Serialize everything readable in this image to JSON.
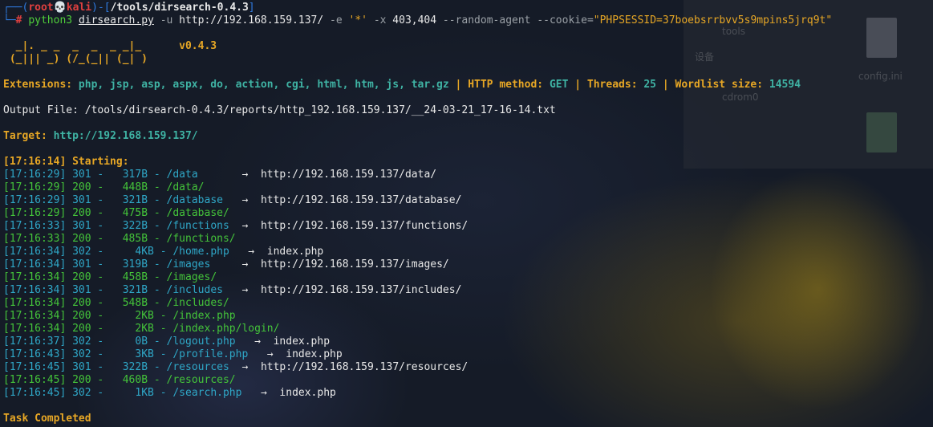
{
  "prompt": {
    "corner_top": "┌──(",
    "user": "root",
    "skull": "💀",
    "host": "kali",
    "sep": ")-[",
    "path": "/tools/dirsearch-0.4.3",
    "close": "]",
    "corner_bottom": "└─",
    "hash": "#",
    "cmd_python": "python3",
    "cmd_script": "dirsearch.py",
    "cmd_u_flag": "-u",
    "cmd_url": "http://192.168.159.137/",
    "cmd_e_flag": "-e",
    "cmd_e_val": "'*'",
    "cmd_x_flag": "-x",
    "cmd_x_val": "403,404",
    "cmd_agent": "--random-agent",
    "cmd_cookie_flag": "--cookie=",
    "cmd_cookie_val": "\"PHPSESSID=37boebsrrbvv5s9mpins5jrq9t\""
  },
  "banner": {
    "line1": "  _|. _ _  _  _  _ _|_",
    "line2": " (_||| _) (/_(_|| (_| )",
    "version": "v0.4.3"
  },
  "config": {
    "ext_label": "Extensions:",
    "ext_value": "php, jsp, asp, aspx, do, action, cgi, html, htm, js, tar.gz",
    "method_label": "HTTP method:",
    "method_value": "GET",
    "threads_label": "Threads:",
    "threads_value": "25",
    "wordlist_label": "Wordlist size:",
    "wordlist_value": "14594",
    "sep": "|"
  },
  "output_file": "Output File: /tools/dirsearch-0.4.3/reports/http_192.168.159.137/__24-03-21_17-16-14.txt",
  "target": {
    "label": "Target:",
    "url": "http://192.168.159.137/"
  },
  "starting": "[17:16:14] Starting:",
  "results": [
    {
      "time": "[17:16:29]",
      "status": "301",
      "size": "  317B",
      "path": "/data     ",
      "redirect": "http://192.168.159.137/data/"
    },
    {
      "time": "[17:16:29]",
      "status": "200",
      "size": "  448B",
      "path": "/data/",
      "redirect": ""
    },
    {
      "time": "[17:16:29]",
      "status": "301",
      "size": "  321B",
      "path": "/database ",
      "redirect": "http://192.168.159.137/database/"
    },
    {
      "time": "[17:16:29]",
      "status": "200",
      "size": "  475B",
      "path": "/database/",
      "redirect": ""
    },
    {
      "time": "[17:16:33]",
      "status": "301",
      "size": "  322B",
      "path": "/functions",
      "redirect": "http://192.168.159.137/functions/"
    },
    {
      "time": "[17:16:33]",
      "status": "200",
      "size": "  485B",
      "path": "/functions/",
      "redirect": ""
    },
    {
      "time": "[17:16:34]",
      "status": "302",
      "size": "    4KB",
      "path": "/home.php ",
      "redirect": "index.php"
    },
    {
      "time": "[17:16:34]",
      "status": "301",
      "size": "  319B",
      "path": "/images   ",
      "redirect": "http://192.168.159.137/images/"
    },
    {
      "time": "[17:16:34]",
      "status": "200",
      "size": "  458B",
      "path": "/images/",
      "redirect": ""
    },
    {
      "time": "[17:16:34]",
      "status": "301",
      "size": "  321B",
      "path": "/includes ",
      "redirect": "http://192.168.159.137/includes/"
    },
    {
      "time": "[17:16:34]",
      "status": "200",
      "size": "  548B",
      "path": "/includes/",
      "redirect": ""
    },
    {
      "time": "[17:16:34]",
      "status": "200",
      "size": "    2KB",
      "path": "/index.php",
      "redirect": ""
    },
    {
      "time": "[17:16:34]",
      "status": "200",
      "size": "    2KB",
      "path": "/index.php/login/",
      "redirect": ""
    },
    {
      "time": "[17:16:37]",
      "status": "302",
      "size": "    0B",
      "path": "/logout.php ",
      "redirect": "index.php"
    },
    {
      "time": "[17:16:43]",
      "status": "302",
      "size": "    3KB",
      "path": "/profile.php ",
      "redirect": "index.php"
    },
    {
      "time": "[17:16:45]",
      "status": "301",
      "size": "  322B",
      "path": "/resources",
      "redirect": "http://192.168.159.137/resources/"
    },
    {
      "time": "[17:16:45]",
      "status": "200",
      "size": "  460B",
      "path": "/resources/",
      "redirect": ""
    },
    {
      "time": "[17:16:45]",
      "status": "302",
      "size": "    1KB",
      "path": "/search.php ",
      "redirect": "index.php"
    }
  ],
  "arrow_glyph": "→",
  "task_completed": "Task Completed",
  "desktop": {
    "labels": [
      "tools",
      "设备",
      "config.ini",
      "cdrom0"
    ]
  }
}
